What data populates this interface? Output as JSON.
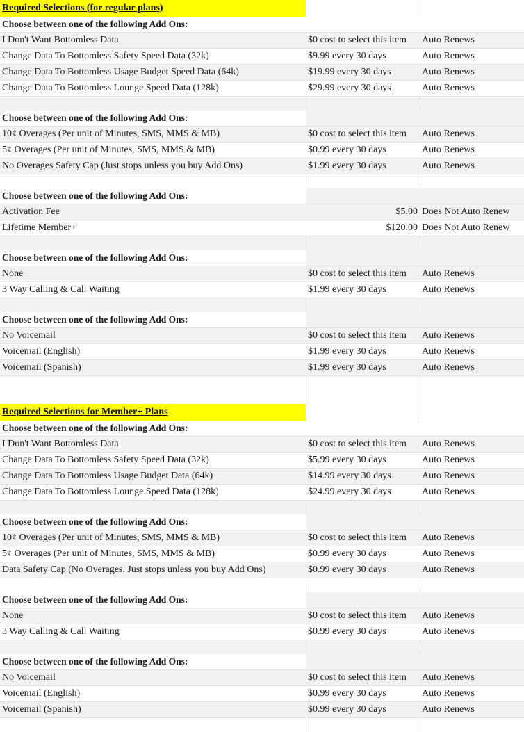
{
  "page": {
    "title": "Required Selections",
    "highlight_color": "#ffff00",
    "row_shade_color": "#f2f2f2",
    "grid_line_color": "#e0e0e0"
  },
  "labels": {
    "choose_prompt": "Choose between one of the following Add Ons:",
    "free": "$0 cost to select this item",
    "auto_renews": "Auto Renews",
    "no_auto_renew": "Does Not Auto Renew"
  },
  "sections": [
    {
      "banner": "Required Selections (for regular plans)",
      "groups": [
        {
          "prompt": "Choose between one of the following Add Ons:",
          "rows": [
            {
              "name": "I Don't Want Bottomless Data",
              "price": "$0 cost to select this item",
              "renew": "Auto Renews"
            },
            {
              "name": "Change Data To Bottomless Safety Speed Data (32k)",
              "price": "$9.99 every 30 days",
              "renew": "Auto Renews"
            },
            {
              "name": "Change Data To Bottomless Usage Budget Speed Data (64k)",
              "price": "$19.99 every 30 days",
              "renew": "Auto Renews"
            },
            {
              "name": "Change Data To Bottomless Lounge Speed Data (128k)",
              "price": "$29.99 every 30 days",
              "renew": "Auto Renews"
            }
          ]
        },
        {
          "prompt": "Choose between one of the following Add Ons:",
          "rows": [
            {
              "name": "10¢ Overages (Per unit of Minutes, SMS, MMS & MB)",
              "price": "$0 cost to select this item",
              "renew": "Auto Renews"
            },
            {
              "name": "5¢ Overages (Per unit of Minutes, SMS, MMS & MB)",
              "price": "$0.99 every 30 days",
              "renew": "Auto Renews"
            },
            {
              "name": "No Overages Safety Cap (Just stops unless you buy Add Ons)",
              "price": "$1.99 every 30 days",
              "renew": "Auto Renews"
            }
          ]
        },
        {
          "prompt": "Choose between one of the following Add Ons:",
          "rows": [
            {
              "name": "Activation Fee",
              "price": "$5.00",
              "renew": "Does Not Auto Renew",
              "align": "right"
            },
            {
              "name": "Lifetime Member+",
              "price": "$120.00",
              "renew": "Does Not Auto Renew",
              "align": "right"
            }
          ]
        },
        {
          "prompt": "Choose between one of the following Add Ons:",
          "rows": [
            {
              "name": "None",
              "price": "$0 cost to select this item",
              "renew": "Auto Renews"
            },
            {
              "name": "3 Way Calling & Call Waiting",
              "price": "$1.99 every 30 days",
              "renew": "Auto Renews"
            }
          ]
        },
        {
          "prompt": "Choose between one of the following Add Ons:",
          "rows": [
            {
              "name": "No Voicemail",
              "price": "$0 cost to select this item",
              "renew": "Auto Renews"
            },
            {
              "name": "Voicemail (English)",
              "price": "$1.99 every 30 days",
              "renew": "Auto Renews"
            },
            {
              "name": "Voicemail (Spanish)",
              "price": "$1.99 every 30 days",
              "renew": "Auto Renews"
            }
          ]
        }
      ]
    },
    {
      "banner": "Required Selections for Member+ Plans",
      "groups": [
        {
          "prompt": "Choose between one of the following Add Ons:",
          "rows": [
            {
              "name": "I Don't Want Bottomless Data",
              "price": "$0 cost to select this item",
              "renew": "Auto Renews"
            },
            {
              "name": "Change Data To Bottomless Safety Speed Data (32k)",
              "price": "$5.99 every 30 days",
              "renew": "Auto Renews"
            },
            {
              "name": "Change Data To Bottomless Usage Budget Data (64k)",
              "price": "$14.99 every 30 days",
              "renew": "Auto Renews"
            },
            {
              "name": "Change Data To Bottomless Lounge Speed Data (128k)",
              "price": "$24.99 every 30 days",
              "renew": "Auto Renews"
            }
          ]
        },
        {
          "prompt": "Choose between one of the following Add Ons:",
          "rows": [
            {
              "name": "10¢ Overages (Per unit of Minutes, SMS, MMS & MB)",
              "price": "$0 cost to select this item",
              "renew": "Auto Renews"
            },
            {
              "name": "5¢ Overages (Per unit of Minutes, SMS, MMS & MB)",
              "price": "$0.99 every 30 days",
              "renew": "Auto Renews"
            },
            {
              "name": "Data Safety Cap (No Overages. Just stops unless you buy Add Ons)",
              "price": "$0.99 every 30 days",
              "renew": "Auto Renews"
            }
          ]
        },
        {
          "prompt": "Choose between one of the following Add Ons:",
          "rows": [
            {
              "name": "None",
              "price": "$0 cost to select this item",
              "renew": "Auto Renews"
            },
            {
              "name": "3 Way Calling & Call Waiting",
              "price": "$0.99 every 30 days",
              "renew": "Auto Renews"
            }
          ]
        },
        {
          "prompt": "Choose between one of the following Add Ons:",
          "rows": [
            {
              "name": "No Voicemail",
              "price": "$0 cost to select this item",
              "renew": "Auto Renews"
            },
            {
              "name": "Voicemail (English)",
              "price": "$0.99 every 30 days",
              "renew": "Auto Renews"
            },
            {
              "name": "Voicemail (Spanish)",
              "price": "$0.99 every 30 days",
              "renew": "Auto Renews"
            }
          ]
        }
      ]
    }
  ]
}
